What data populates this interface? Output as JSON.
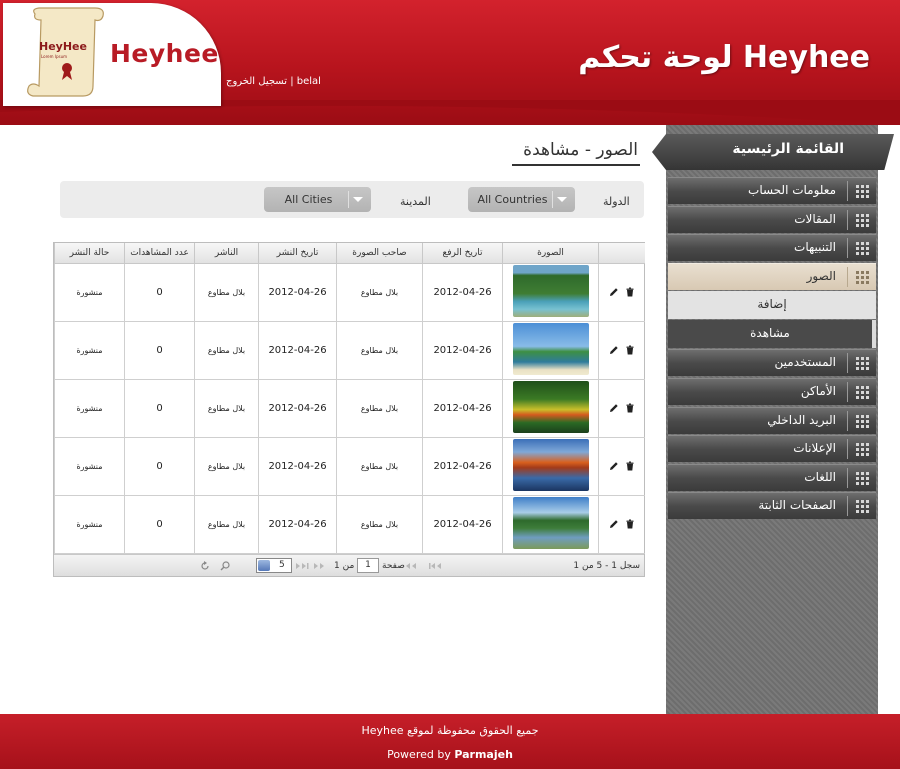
{
  "header": {
    "logo_text": "Heyhee",
    "logo_scroll_text": "HeyHee",
    "logo_scroll_subtext": "Lorem Ipsum",
    "user_name": "belal",
    "separator": " | ",
    "logout_label": "تسجيل الخروج",
    "panel_title": "لوحة تحكم Heyhee",
    "brand_color": "#c01a24"
  },
  "sidebar": {
    "title": "القائمة الرئيسية",
    "items": [
      {
        "label": "معلومات الحساب"
      },
      {
        "label": "المقالات"
      },
      {
        "label": "التنبيهات"
      },
      {
        "label": "الصور",
        "active": true
      },
      {
        "label": "المستخدمين"
      },
      {
        "label": "الأماكن"
      },
      {
        "label": "البريد الداخلي"
      },
      {
        "label": "الإعلانات"
      },
      {
        "label": "اللغات"
      },
      {
        "label": "الصفحات الثابتة"
      }
    ],
    "subitems": [
      {
        "label": "إضافة"
      },
      {
        "label": "مشاهدة"
      }
    ]
  },
  "main": {
    "page_title": "الصور - مشاهدة",
    "filters": {
      "country_label": "الدولة",
      "country_value": "All Countries",
      "city_label": "المدينة",
      "city_value": "All Cities"
    },
    "table": {
      "columns": [
        "",
        "الصورة",
        "تاريخ الرفع",
        "صاحب الصورة",
        "تاريخ النشر",
        "الناشر",
        "عدد المشاهدات",
        "حالة النشر"
      ],
      "rows": [
        {
          "image": "forest-river",
          "upload_date": "2012-04-26",
          "owner": "بلال مطاوع",
          "publish_date": "2012-04-26",
          "publisher": "بلال مطاوع",
          "views": "0",
          "status": "منشورة"
        },
        {
          "image": "beach-tree",
          "upload_date": "2012-04-26",
          "owner": "بلال مطاوع",
          "publish_date": "2012-04-26",
          "publisher": "بلال مطاوع",
          "views": "0",
          "status": "منشورة"
        },
        {
          "image": "green-forest",
          "upload_date": "2012-04-26",
          "owner": "بلال مطاوع",
          "publish_date": "2012-04-26",
          "publisher": "بلال مطاوع",
          "views": "0",
          "status": "منشورة"
        },
        {
          "image": "autumn-lake",
          "upload_date": "2012-04-26",
          "owner": "بلال مطاوع",
          "publish_date": "2012-04-26",
          "publisher": "بلال مطاوع",
          "views": "0",
          "status": "منشورة"
        },
        {
          "image": "lake-dock",
          "upload_date": "2012-04-26",
          "owner": "بلال مطاوع",
          "publish_date": "2012-04-26",
          "publisher": "بلال مطاوع",
          "views": "0",
          "status": "منشورة"
        }
      ]
    },
    "pager": {
      "records_text": "سجل 1 - 5 من 1",
      "page_label": "صفحة",
      "page_value": "1",
      "of_text": "من 1",
      "page_size": "5",
      "icons": [
        "first-icon",
        "prev-icon",
        "next-icon",
        "last-icon",
        "search-icon",
        "refresh-icon"
      ]
    }
  },
  "footer": {
    "rights": "جميع الحقوق محفوظة لموقع Heyhee",
    "powered_prefix": "Powered by ",
    "powered_brand": "Parmajeh"
  }
}
